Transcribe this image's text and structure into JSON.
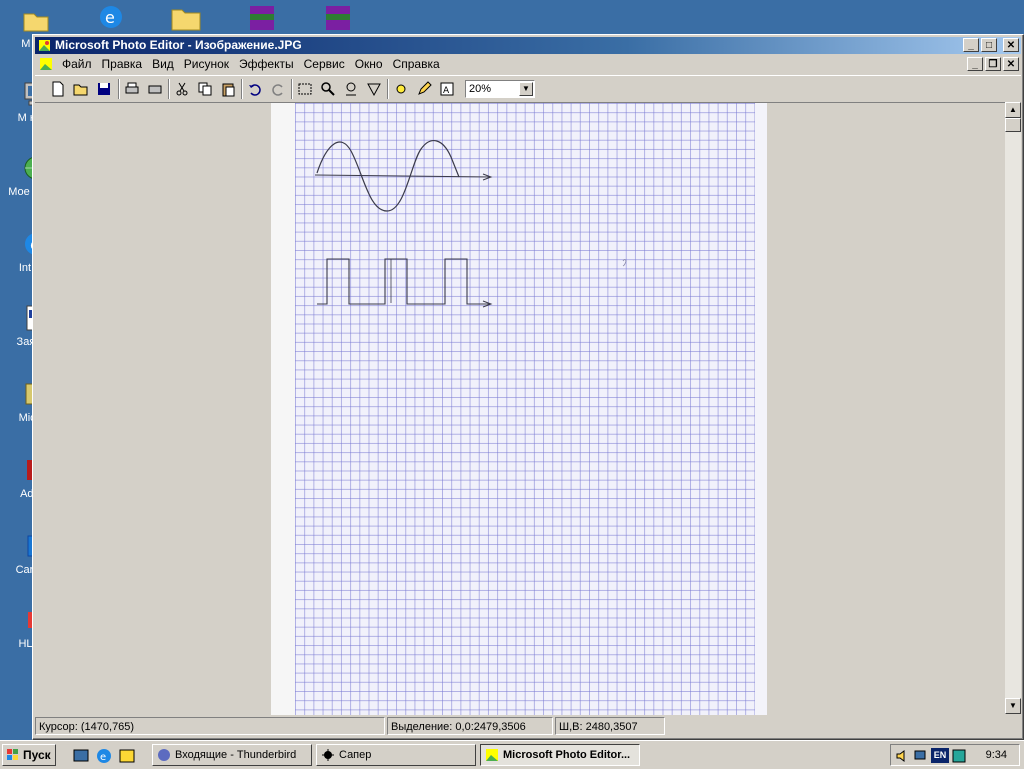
{
  "desktop": {
    "icons": [
      {
        "label": "M док"
      },
      {
        "label": "M комп"
      },
      {
        "label": "Мое с окру"
      },
      {
        "label": "Int Exp"
      },
      {
        "label": "Зая кон"
      },
      {
        "label": "Mic Ou"
      },
      {
        "label": "Adobe"
      },
      {
        "label": "Car Tool"
      },
      {
        "label": "HL Inte"
      }
    ]
  },
  "window": {
    "title": "Microsoft Photo Editor - Изображение.JPG",
    "menu": [
      "Файл",
      "Правка",
      "Вид",
      "Рисунок",
      "Эффекты",
      "Сервис",
      "Окно",
      "Справка"
    ],
    "zoom": "20%",
    "status": {
      "cursor": "Курсор: (1470,765)",
      "selection": "Выделение: 0,0:2479,3506",
      "size": "Ш,В: 2480,3507"
    }
  },
  "taskbar": {
    "start": "Пуск",
    "tasks": [
      {
        "label": "Входящие - Thunderbird"
      },
      {
        "label": "Сапер"
      },
      {
        "label": "Microsoft Photo Editor..."
      }
    ],
    "lang": "EN",
    "clock": "9:34"
  },
  "colors": {
    "desktop": "#3a6ea5",
    "title_start": "#0a246a",
    "title_end": "#a6caf0",
    "chrome": "#d4d0c8",
    "grid_line": "#7878d2"
  }
}
